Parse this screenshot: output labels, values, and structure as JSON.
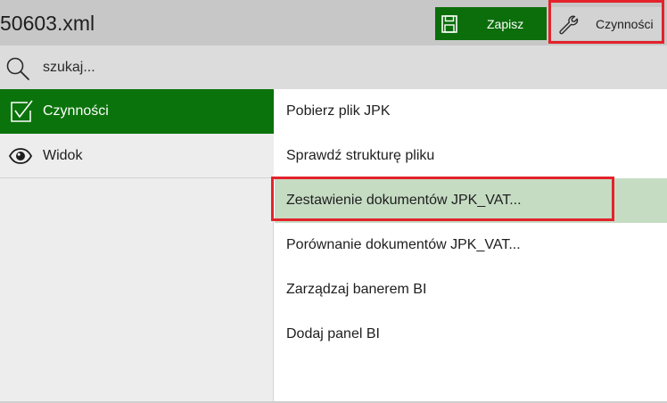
{
  "header": {
    "title": "50603.xml",
    "save_label": "Zapisz",
    "actions_label": "Czynności",
    "colors": {
      "save_bg": "#0b6e0b",
      "header_bg": "#c7c7c7",
      "highlight_border": "#e3222b"
    }
  },
  "search": {
    "placeholder": "szukaj..."
  },
  "sidebar": {
    "items": [
      {
        "label": "Czynności",
        "icon": "checkbox-check-icon",
        "active": true
      },
      {
        "label": "Widok",
        "icon": "eye-icon",
        "active": false
      }
    ],
    "colors": {
      "active_bg": "#0b730b"
    }
  },
  "menu": {
    "items": [
      {
        "label": "Pobierz plik JPK"
      },
      {
        "label": "Sprawdź strukturę pliku"
      },
      {
        "label": "Zestawienie dokumentów JPK_VAT...",
        "selected": true
      },
      {
        "label": "Porównanie dokumentów JPK_VAT..."
      },
      {
        "label": "Zarządzaj banerem BI"
      },
      {
        "label": "Dodaj panel BI"
      }
    ],
    "colors": {
      "selected_bg": "#c5dcc3"
    }
  }
}
